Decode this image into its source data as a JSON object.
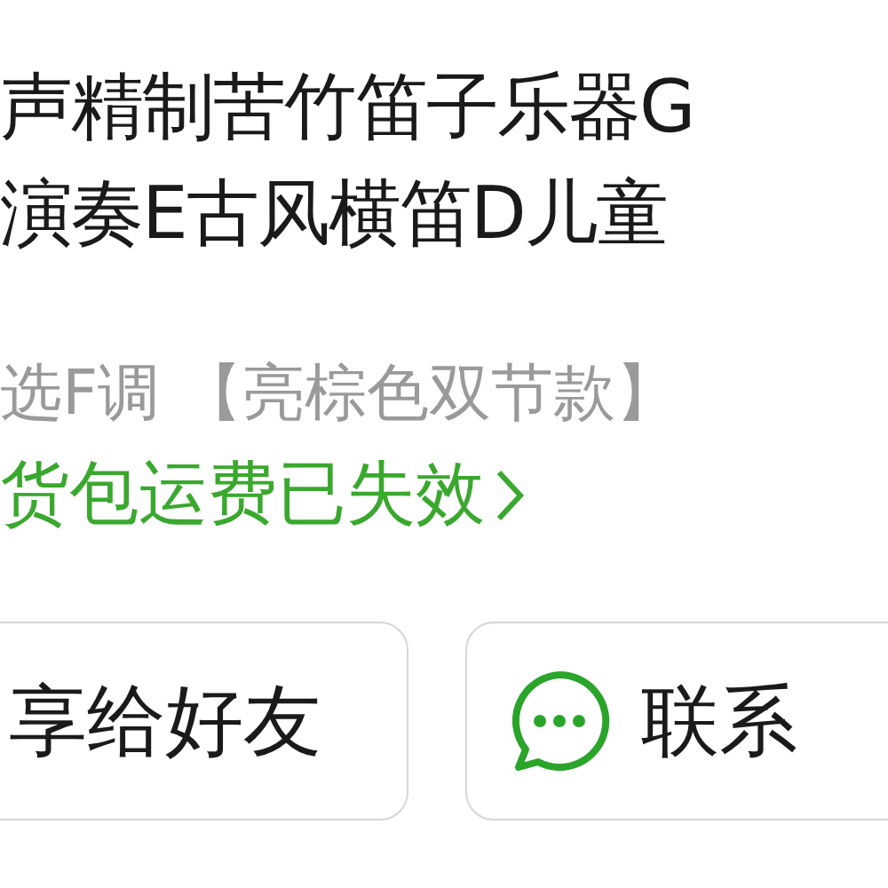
{
  "product": {
    "title_lines": [
      "声精制苦竹笛子乐器G",
      "演奏E古风横笛D儿童"
    ],
    "variant": "选F调 【亮棕色双节款】",
    "shipping_notice": "货包运费已失效"
  },
  "buttons": [
    {
      "label": "享给好友",
      "kind": "share"
    },
    {
      "label": "联系",
      "kind": "contact"
    }
  ]
}
